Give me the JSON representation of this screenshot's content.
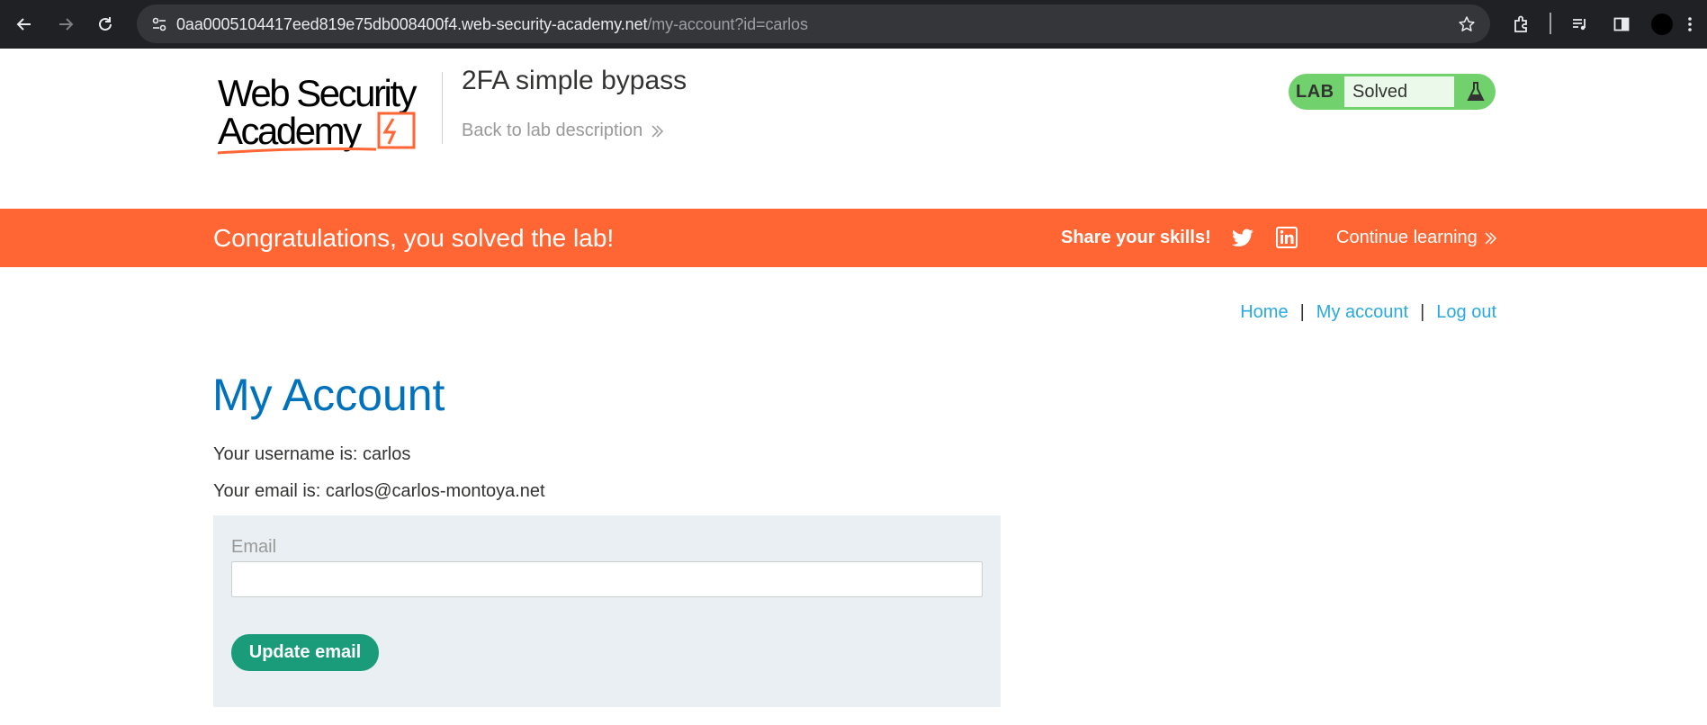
{
  "browser": {
    "url_host": "0aa0005104417eed819e75db008400f4.web-security-academy.net",
    "url_path": "/my-account?id=carlos"
  },
  "header": {
    "logo_text": "Web Security Academy",
    "lab_title": "2FA simple bypass",
    "back_link": "Back to lab description",
    "lab_label": "LAB",
    "lab_status": "Solved"
  },
  "banner": {
    "message": "Congratulations, you solved the lab!",
    "share_label": "Share your skills!",
    "continue_label": "Continue learning"
  },
  "nav": {
    "home": "Home",
    "my_account": "My account",
    "log_out": "Log out",
    "separator": "|"
  },
  "main": {
    "title": "My Account",
    "username_line": "Your username is: carlos",
    "email_line": "Your email is: carlos@carlos-montoya.net",
    "email_label": "Email",
    "email_value": "",
    "update_button": "Update email"
  },
  "colors": {
    "banner": "#ff6633",
    "title_blue": "#0071bc",
    "link_blue": "#29a9e1",
    "button_green": "#1a9c7b",
    "lab_green": "#70d16d"
  }
}
